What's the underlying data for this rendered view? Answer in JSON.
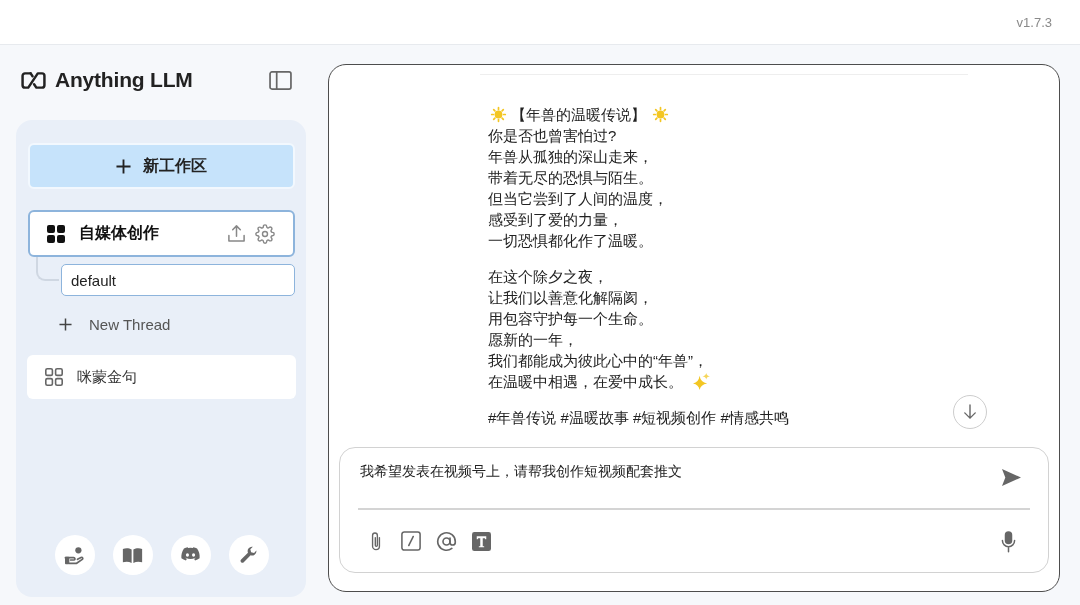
{
  "top_bar": {
    "version": "v1.7.3"
  },
  "sidebar": {
    "logo": "Anything LLM",
    "new_workspace_label": "新工作区",
    "workspaces": [
      {
        "name": "自媒体创作",
        "selected": true,
        "threads": [
          {
            "name": "default",
            "selected": true
          }
        ],
        "new_thread_label": "New Thread"
      },
      {
        "name": "咪蒙金句",
        "selected": false
      }
    ]
  },
  "chat": {
    "paragraphs": [
      [
        {
          "kind": "title",
          "text": "【年兽的温暖传说】"
        },
        {
          "kind": "plain",
          "text": "你是否也曾害怕过?"
        },
        {
          "kind": "plain",
          "text": "年兽从孤独的深山走来，"
        },
        {
          "kind": "plain",
          "text": "带着无尽的恐惧与陌生。"
        },
        {
          "kind": "plain",
          "text": "但当它尝到了人间的温度，"
        },
        {
          "kind": "plain",
          "text": "感受到了爱的力量，"
        },
        {
          "kind": "plain",
          "text": "一切恐惧都化作了温暖。"
        }
      ],
      [
        {
          "kind": "plain",
          "text": "在这个除夕之夜，"
        },
        {
          "kind": "plain",
          "text": "让我们以善意化解隔阂，"
        },
        {
          "kind": "plain",
          "text": "用包容守护每一个生命。"
        },
        {
          "kind": "plain",
          "text": "愿新的一年，"
        },
        {
          "kind": "plain",
          "text": "我们都能成为彼此心中的“年兽”，"
        },
        {
          "kind": "sparkle",
          "text": "在温暖中相遇，在爱中成长。"
        }
      ],
      [
        {
          "kind": "plain",
          "text": "#年兽传说 #温暖故事 #短视频创作 #情感共鸣"
        }
      ]
    ],
    "input": {
      "value": "我希望发表在视频号上，请帮我创作短视频配套推文"
    }
  }
}
